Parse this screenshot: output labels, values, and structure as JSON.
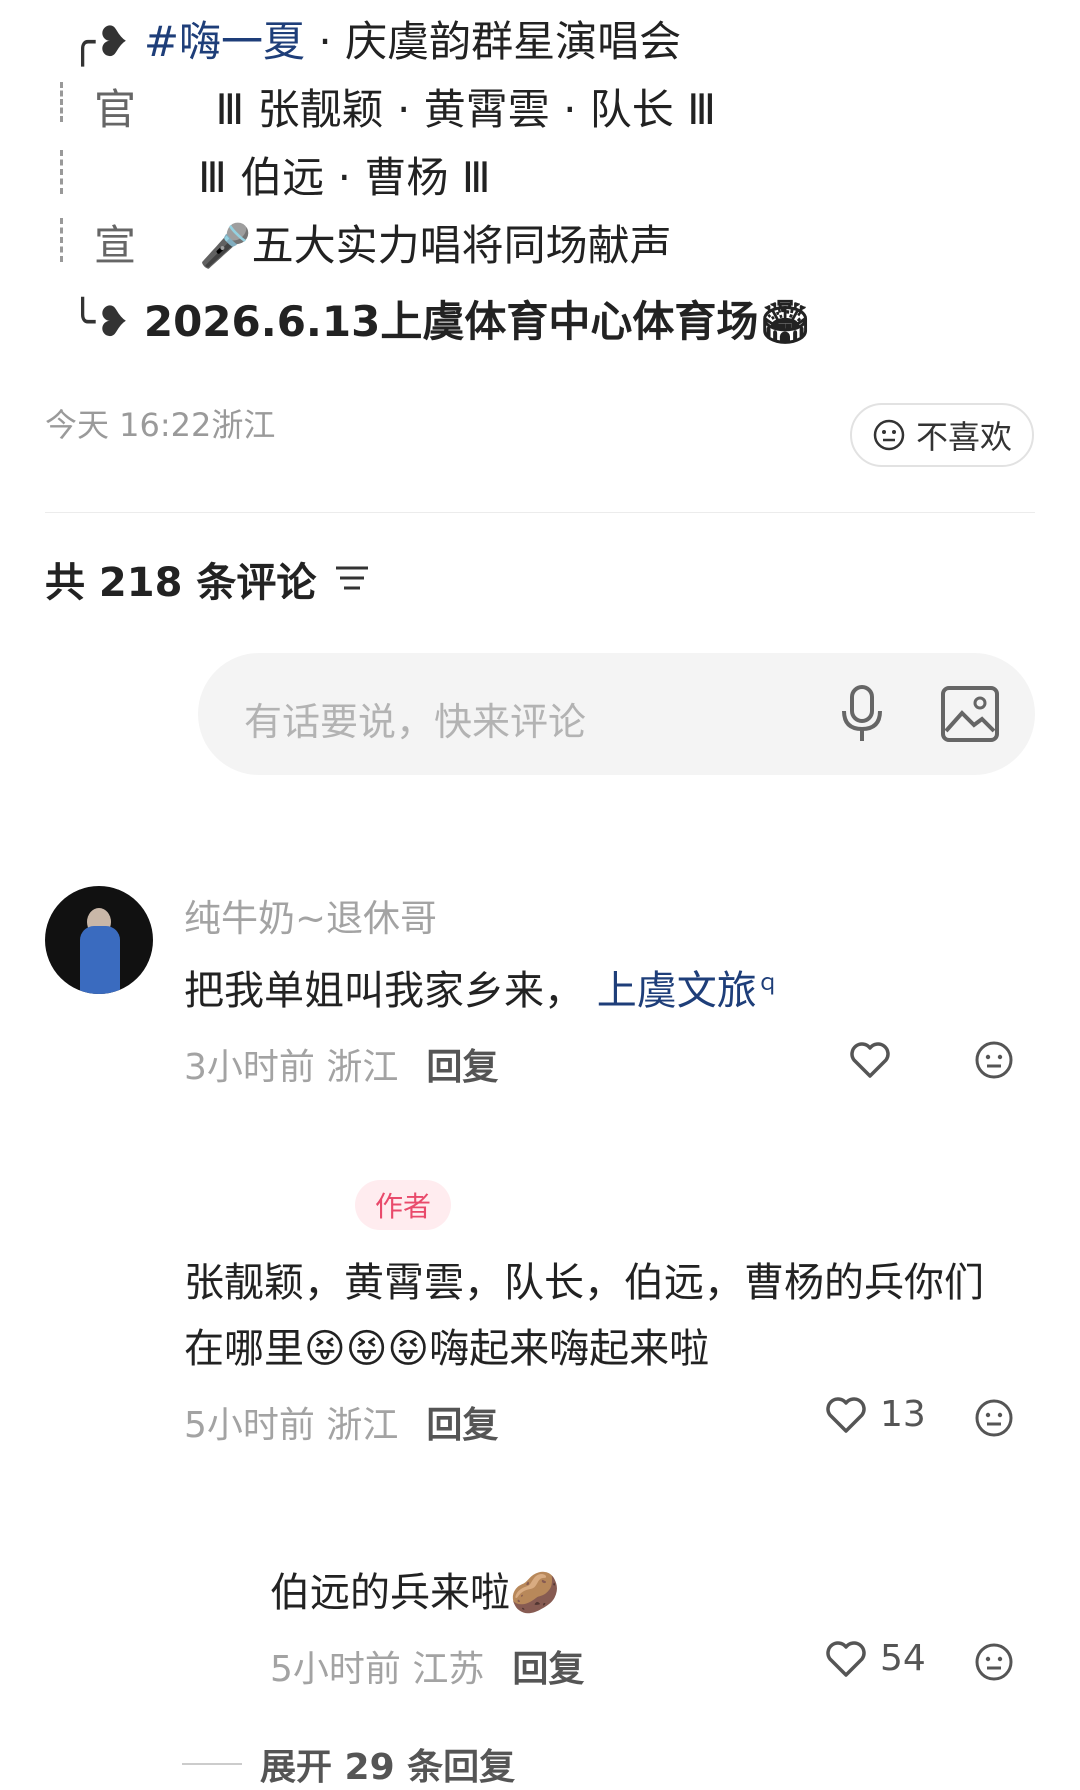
{
  "post": {
    "line1_hashtag": "#嗨一夏",
    "line1_rest": "· 庆虞韵群星演唱会",
    "line2_side": "官",
    "line2_text": "Ⅲ 张靓颖 · 黄霄雲 · 队长 Ⅲ",
    "line3_text": "Ⅲ 伯远 · 曹杨 Ⅲ",
    "line4_side": "宣",
    "line4_text": "🎤五大实力唱将同场献声",
    "line5_text": "2026.6.13上虞体育中心体育场🏟",
    "time_location": "今天 16:22浙江",
    "dislike_label": "不喜欢"
  },
  "comments_header": {
    "count_label": "共 218 条评论"
  },
  "comment_input": {
    "placeholder": "有话要说，快来评论"
  },
  "comments": [
    {
      "username": "纯牛奶~退休哥",
      "text_main": "把我单姐叫我家乡来，",
      "text_link": "上虞文旅",
      "time": "3小时前 浙江",
      "reply_label": "回复"
    },
    {
      "badge": "作者",
      "text_line1": "张靓颖，黄霄雲，队长，伯远，曹杨的兵你们",
      "text_line2": "在哪里😝😝😝嗨起来嗨起来啦",
      "time": "5小时前 浙江",
      "reply_label": "回复",
      "likes": "13"
    },
    {
      "text": "伯远的兵来啦",
      "time": "5小时前 江苏",
      "reply_label": "回复",
      "likes": "54"
    }
  ],
  "expand_label": "展开 29 条回复"
}
